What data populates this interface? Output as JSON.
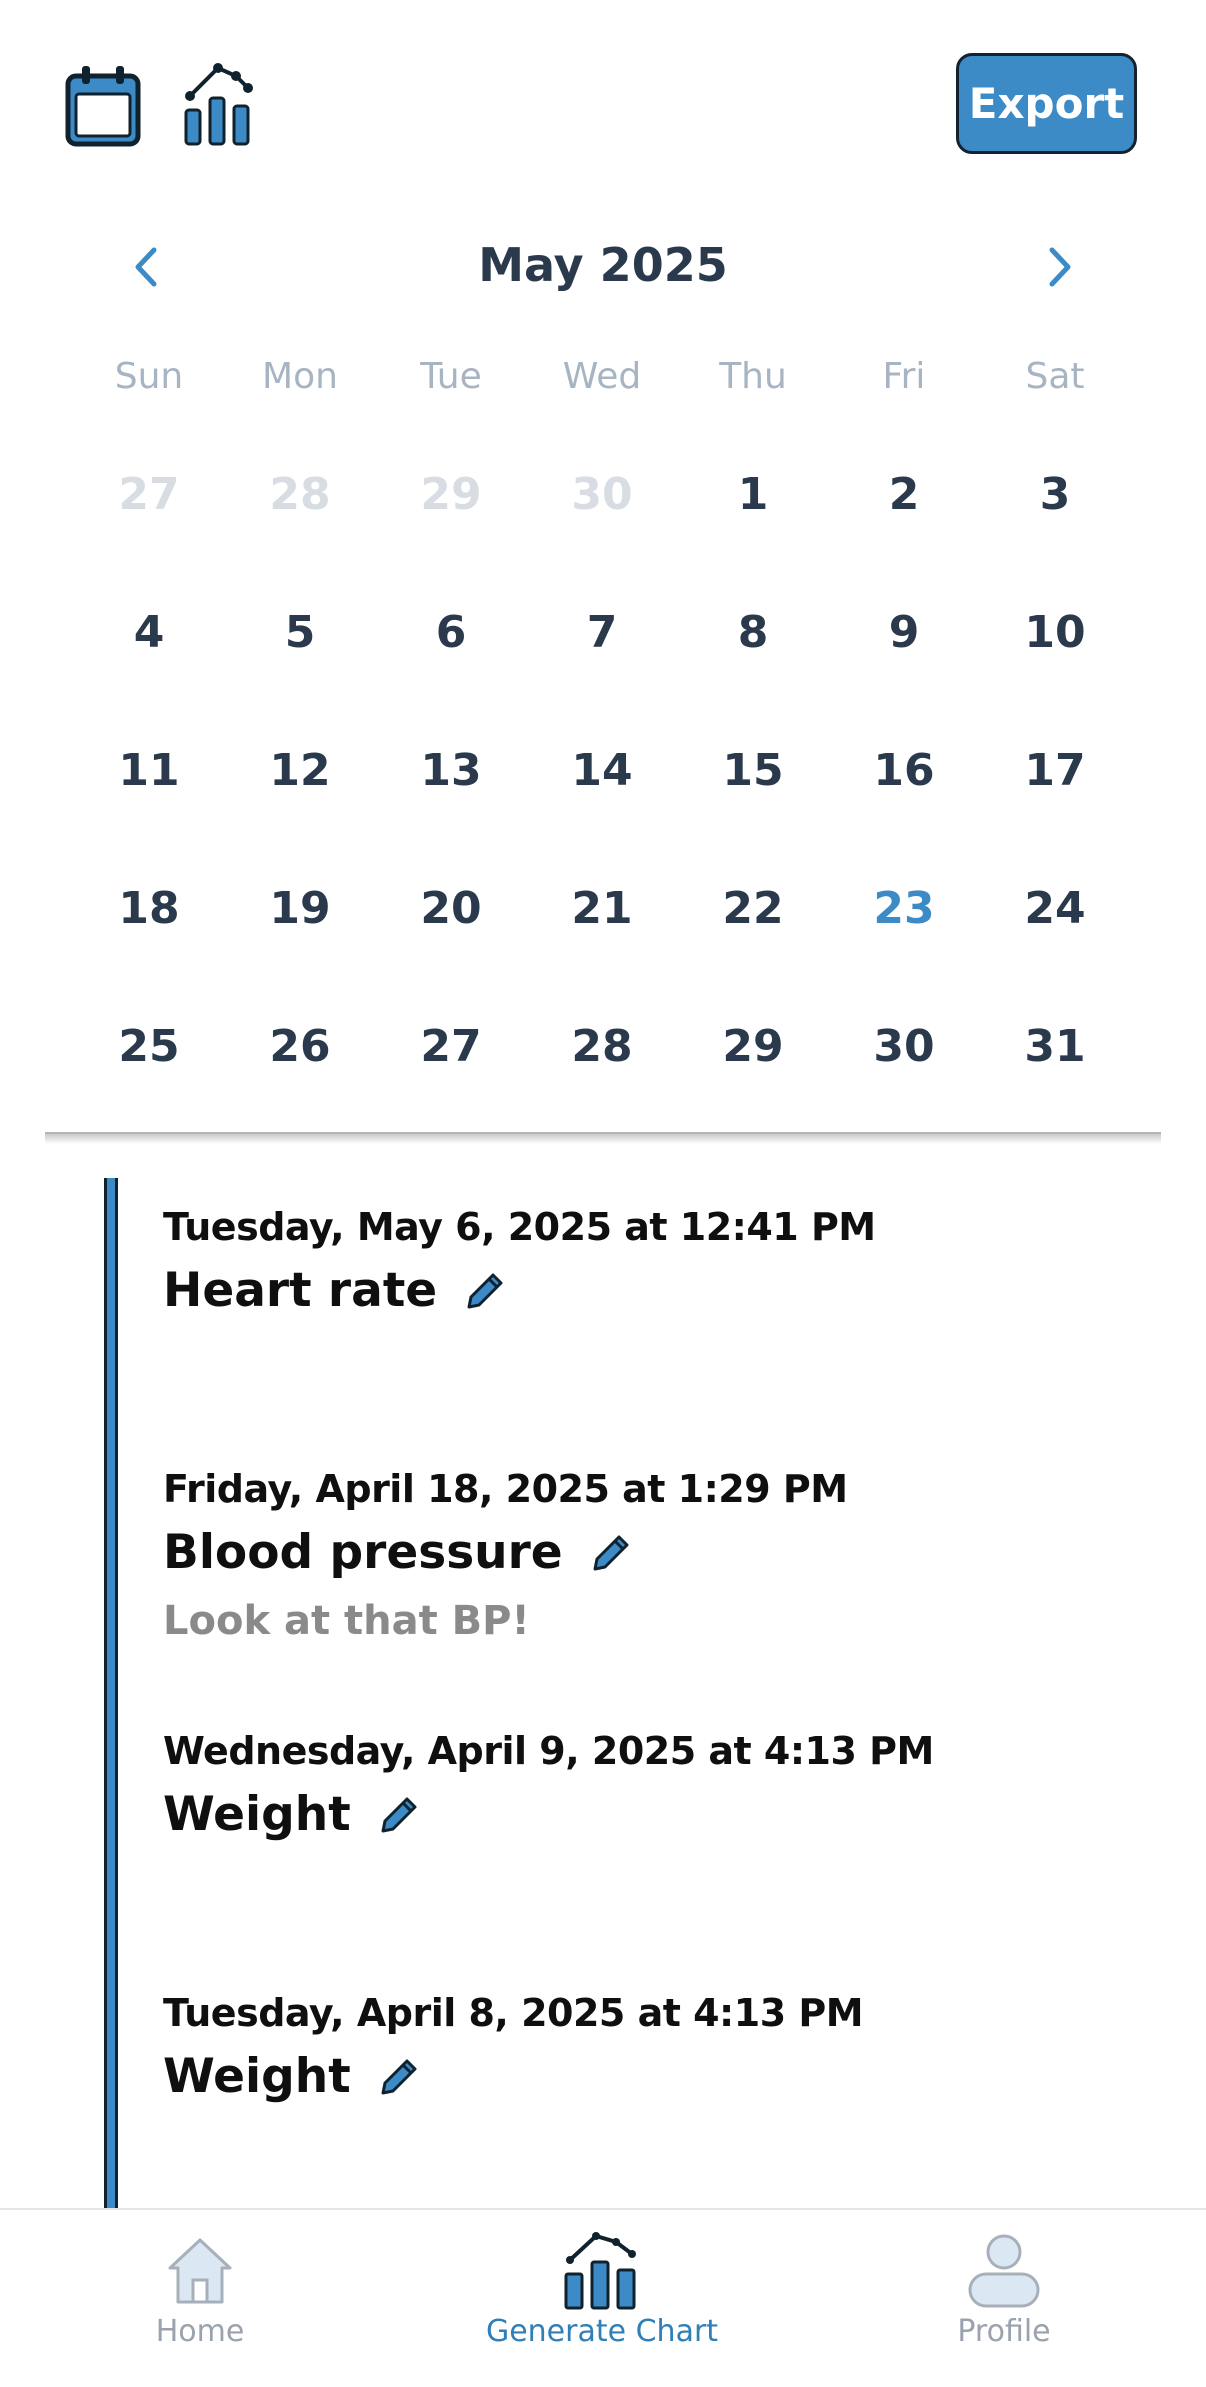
{
  "toolbar": {
    "calendar_icon": "calendar-icon",
    "chart_icon": "chart-icon",
    "export_label": "Export",
    "accent_color": "#3c8bc6"
  },
  "calendar": {
    "month_title": "May 2025",
    "weekdays": [
      "Sun",
      "Mon",
      "Tue",
      "Wed",
      "Thu",
      "Fri",
      "Sat"
    ],
    "weeks": [
      [
        "27",
        "28",
        "29",
        "30",
        "1",
        "2",
        "3"
      ],
      [
        "4",
        "5",
        "6",
        "7",
        "8",
        "9",
        "10"
      ],
      [
        "11",
        "12",
        "13",
        "14",
        "15",
        "16",
        "17"
      ],
      [
        "18",
        "19",
        "20",
        "21",
        "22",
        "23",
        "24"
      ],
      [
        "25",
        "26",
        "27",
        "28",
        "29",
        "30",
        "31"
      ]
    ],
    "selected_day": "23"
  },
  "entries": [
    {
      "date": "Tuesday, May 6, 2025 at 12:41 PM",
      "title": "Heart rate",
      "note": ""
    },
    {
      "date": "Friday, April 18, 2025 at 1:29 PM",
      "title": "Blood pressure",
      "note": "Look at that BP!"
    },
    {
      "date": "Wednesday, April 9, 2025 at 4:13 PM",
      "title": "Weight",
      "note": ""
    },
    {
      "date": "Tuesday, April 8, 2025 at 4:13 PM",
      "title": "Weight",
      "note": ""
    }
  ],
  "bottom_nav": [
    {
      "label": "Home",
      "icon": "home-icon",
      "active": false
    },
    {
      "label": "Generate Chart",
      "icon": "chart-icon",
      "active": true
    },
    {
      "label": "Profile",
      "icon": "profile-icon",
      "active": false
    }
  ]
}
